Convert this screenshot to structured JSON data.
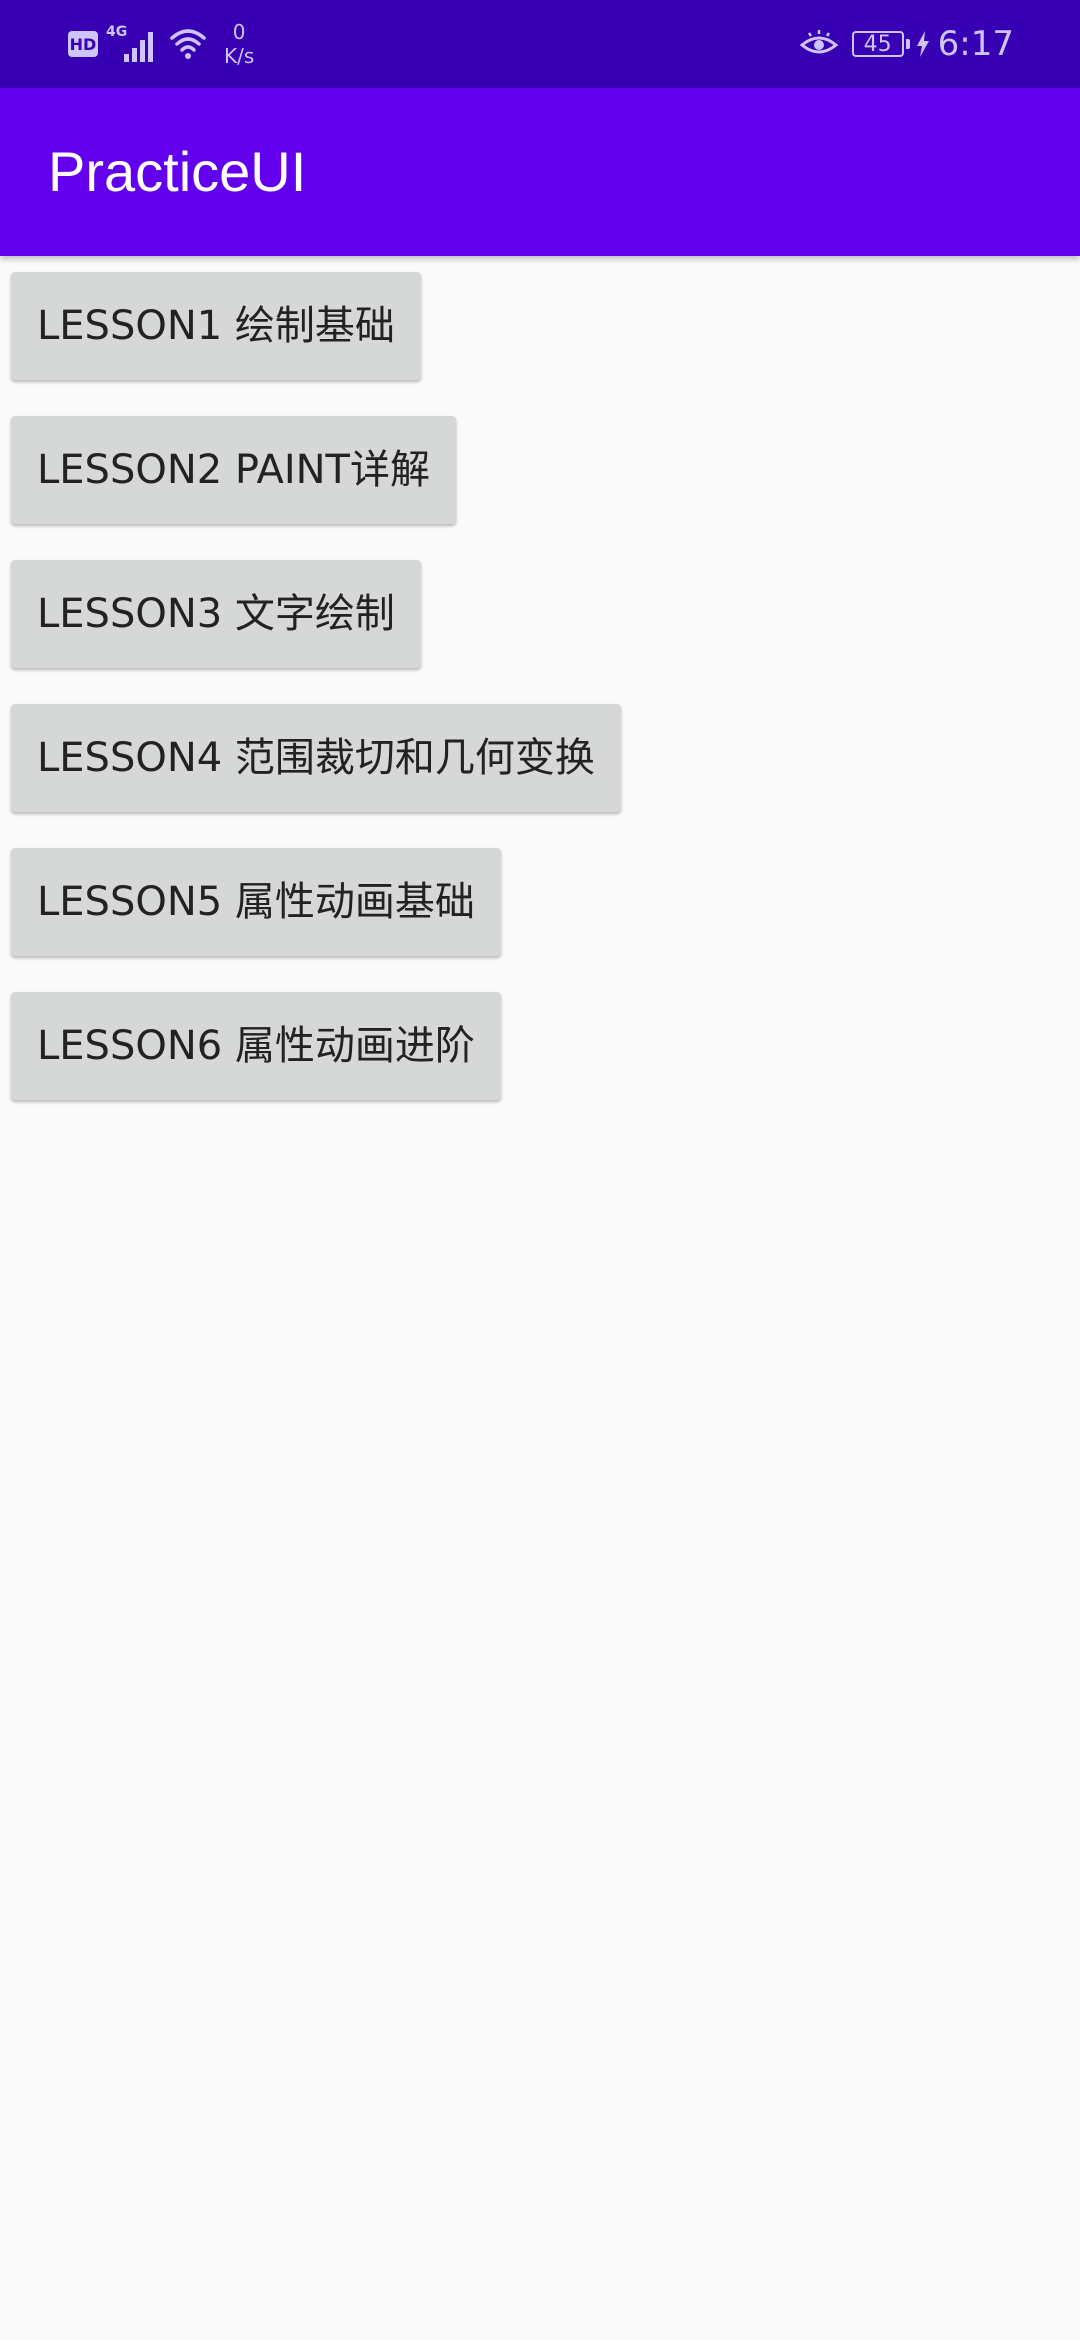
{
  "status_bar": {
    "hd_label": "HD",
    "network_type": "4G",
    "speed_value": "0",
    "speed_unit": "K/s",
    "battery_level": "45",
    "time": "6:17",
    "icon_color": "#cfc4ff",
    "background_color": "#3700b3"
  },
  "app_bar": {
    "title": "PracticeUI",
    "background_color": "#6200ee"
  },
  "lessons": [
    {
      "label": "LESSON1 绘制基础"
    },
    {
      "label": "LESSON2 PAINT详解"
    },
    {
      "label": "LESSON3 文字绘制"
    },
    {
      "label": "LESSON4 范围裁切和几何变换"
    },
    {
      "label": "LESSON5 属性动画基础"
    },
    {
      "label": "LESSON6 属性动画进阶"
    }
  ]
}
